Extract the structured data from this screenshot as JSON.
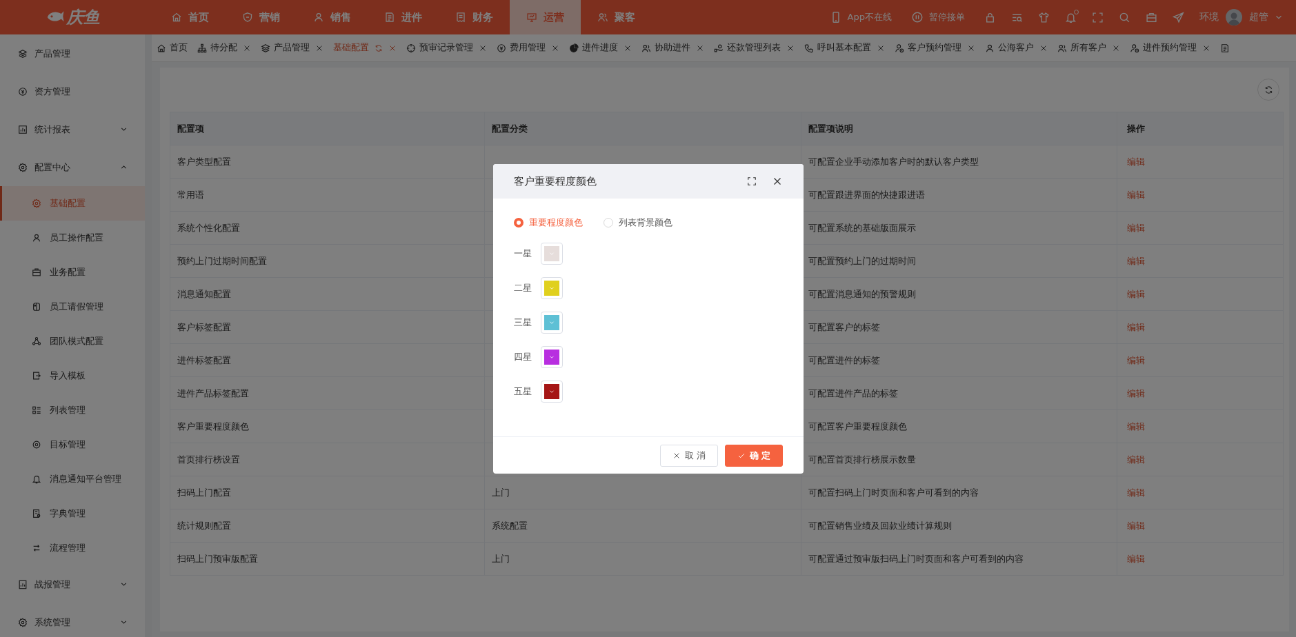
{
  "app": {
    "logo": "庆鱼"
  },
  "top_nav": [
    {
      "label": "首页",
      "selected": false
    },
    {
      "label": "营销",
      "selected": false
    },
    {
      "label": "销售",
      "selected": false
    },
    {
      "label": "进件",
      "selected": false
    },
    {
      "label": "财务",
      "selected": false
    },
    {
      "label": "运营",
      "selected": true
    },
    {
      "label": "聚客",
      "selected": false
    }
  ],
  "header_actions": [
    {
      "label": "App不在线"
    },
    {
      "label": "暂停接单"
    }
  ],
  "notifications": {
    "unread": true
  },
  "user": {
    "env": "环境",
    "name": "超管"
  },
  "sidebar": {
    "items": [
      {
        "label": "产品管理",
        "selected": false
      },
      {
        "label": "资方管理",
        "selected": false
      },
      {
        "label": "统计报表",
        "expanded": false
      },
      {
        "label": "配置中心",
        "expanded": true,
        "children": [
          {
            "label": "基础配置",
            "selected": true
          },
          {
            "label": "员工操作配置",
            "selected": false
          },
          {
            "label": "业务配置",
            "selected": false
          },
          {
            "label": "员工请假管理",
            "selected": false
          },
          {
            "label": "团队模式配置",
            "selected": false
          },
          {
            "label": "导入模板",
            "selected": false
          },
          {
            "label": "列表管理",
            "selected": false
          },
          {
            "label": "目标管理",
            "selected": false
          },
          {
            "label": "消息通知平台管理",
            "selected": false
          },
          {
            "label": "字典管理",
            "selected": false
          },
          {
            "label": "流程管理",
            "selected": false
          }
        ]
      },
      {
        "label": "战报管理",
        "expanded": false
      },
      {
        "label": "系统管理",
        "expanded": false
      }
    ]
  },
  "tabs": [
    {
      "label": "首页",
      "selected": false,
      "closable": false
    },
    {
      "label": "待分配",
      "selected": false,
      "closable": true
    },
    {
      "label": "产品管理",
      "selected": false,
      "closable": true
    },
    {
      "label": "基础配置",
      "selected": true,
      "closable": true
    },
    {
      "label": "预审记录管理",
      "selected": false,
      "closable": true
    },
    {
      "label": "费用管理",
      "selected": false,
      "closable": true
    },
    {
      "label": "进件进度",
      "selected": false,
      "closable": true
    },
    {
      "label": "协助进件",
      "selected": false,
      "closable": true
    },
    {
      "label": "还款管理列表",
      "selected": false,
      "closable": true
    },
    {
      "label": "呼叫基本配置",
      "selected": false,
      "closable": true
    },
    {
      "label": "客户预约管理",
      "selected": false,
      "closable": true
    },
    {
      "label": "公海客户",
      "selected": false,
      "closable": true
    },
    {
      "label": "所有客户",
      "selected": false,
      "closable": true
    },
    {
      "label": "进件预约管理",
      "selected": false,
      "closable": true
    }
  ],
  "table": {
    "columns": [
      "配置项",
      "配置分类",
      "配置项说明",
      "操作"
    ],
    "rows": [
      {
        "item": "客户类型配置",
        "description": "可配置企业手动添加客户时的默认客户类型",
        "action": "编辑"
      },
      {
        "item": "常用语",
        "description": "可配置跟进界面的快捷跟进语",
        "action": "编辑"
      },
      {
        "item": "系统个性化配置",
        "description": "可配置系统的基础版面展示",
        "action": "编辑"
      },
      {
        "item": "预约上门过期时间配置",
        "description": "可配置预约上门的过期时间",
        "action": "编辑"
      },
      {
        "item": "消息通知配置",
        "description": "可配置消息通知的预警规则",
        "action": "编辑"
      },
      {
        "item": "客户标签配置",
        "description": "可配置客户的标签",
        "action": "编辑"
      },
      {
        "item": "进件标签配置",
        "description": "可配置进件的标签",
        "action": "编辑"
      },
      {
        "item": "进件产品标签配置",
        "description": "可配置进件产品的标签",
        "action": "编辑"
      },
      {
        "item": "客户重要程度颜色",
        "description": "可配置客户重要程度颜色",
        "action": "编辑"
      },
      {
        "item": "首页排行榜设置",
        "description": "可配置首页排行榜展示数量",
        "action": "编辑"
      },
      {
        "item": "扫码上门配置",
        "category": "上门",
        "description": "可配置扫码上门时页面和客户可看到的内容",
        "action": "编辑"
      },
      {
        "item": "统计规则配置",
        "category": "系统配置",
        "description": "可配置销售业绩及回款业绩计算规则",
        "action": "编辑"
      },
      {
        "item": "扫码上门预审版配置",
        "category": "上门",
        "description": "可配置通过预审版扫码上门时页面和客户可看到的内容",
        "action": "编辑"
      }
    ]
  },
  "dialog": {
    "title": "客户重要程度颜色",
    "modes": [
      {
        "label": "重要程度颜色",
        "selected": true
      },
      {
        "label": "列表背景颜色",
        "selected": false
      }
    ],
    "levels": [
      {
        "label": "一星",
        "color": "#e6dddb"
      },
      {
        "label": "二星",
        "color": "#e0d01e"
      },
      {
        "label": "三星",
        "color": "#5ec0d5"
      },
      {
        "label": "四星",
        "color": "#b82ee0"
      },
      {
        "label": "五星",
        "color": "#a51515"
      }
    ],
    "buttons": [
      {
        "kind": "cancel",
        "label": "取 消"
      },
      {
        "kind": "confirm",
        "label": "确 定"
      }
    ]
  }
}
